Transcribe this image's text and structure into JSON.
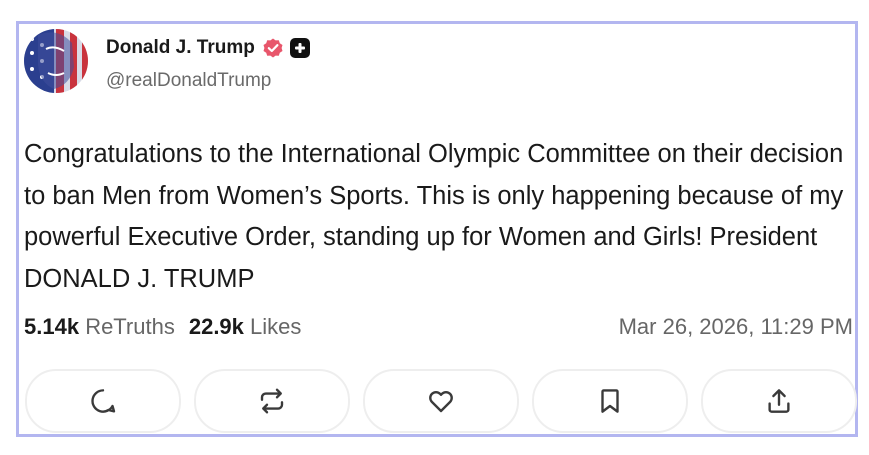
{
  "author": {
    "display_name": "Donald J. Trump",
    "handle": "@realDonaldTrump",
    "avatar": "flag-portrait-avatar",
    "badges": [
      "verified-badge-icon",
      "plus-badge-icon"
    ]
  },
  "post": {
    "text": "Congratulations to the International Olympic Committee on their decision to ban Men from Women’s Sports. This is only happening because of my powerful Executive Order, standing up for Women and Girls! President DONALD J. TRUMP"
  },
  "stats": {
    "retruths_count": "5.14k",
    "retruths_label": "ReTruths",
    "likes_count": "22.9k",
    "likes_label": "Likes",
    "timestamp": "Mar 26, 2026, 11:29 PM"
  },
  "actions": [
    "reply-icon",
    "retruth-icon",
    "like-icon",
    "bookmark-icon",
    "share-icon"
  ],
  "colors": {
    "card_border": "#b3b6f0",
    "verified_badge": "#e8566b",
    "text_primary": "#1a1a1a",
    "text_secondary": "#666666"
  }
}
